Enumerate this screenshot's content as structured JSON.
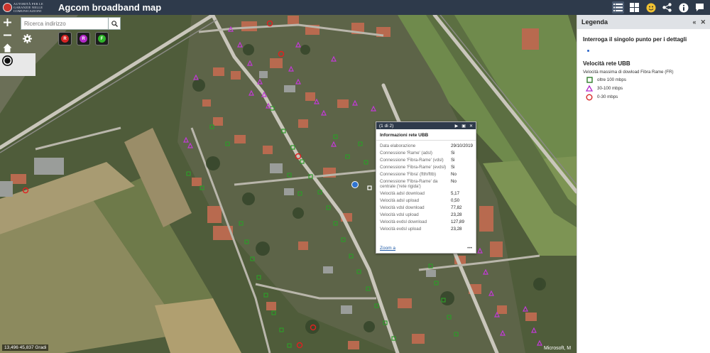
{
  "header": {
    "logo_text_line1": "AUTORITÀ PER LE",
    "logo_text_line2": "GARANZIE NELLE",
    "logo_text_line3": "COMUNICAZIONI",
    "title": "Agcom broadband map",
    "icons": [
      "list-icon",
      "grid-icon",
      "smiley-icon",
      "share-icon",
      "info-icon",
      "chat-icon"
    ]
  },
  "map": {
    "search_placeholder": "Ricerca indirizzo",
    "layer_buttons": [
      {
        "letter": "R",
        "color": "#d62424"
      },
      {
        "letter": "R",
        "color": "#b328c9"
      },
      {
        "letter": "F",
        "color": "#2fb52a"
      }
    ],
    "scale_text": "13,496 45,837 Gradi",
    "attribution": "Microsoft, M"
  },
  "popup": {
    "counter": "(1 di 2)",
    "title": "Informazioni rete UBB",
    "rows": [
      {
        "label": "Data elaborazione",
        "value": "29/10/2019"
      },
      {
        "label": "Connessione 'Rame' (adsl)",
        "value": "Si"
      },
      {
        "label": "Connessione 'Fibra-Rame' (vdsl)",
        "value": "Si"
      },
      {
        "label": "Connessione 'Fibra-Rame' (evdsl)",
        "value": "Si"
      },
      {
        "label": "Connessione 'Fibra' (ftth/fttb)",
        "value": "No"
      },
      {
        "label": "Connessione 'Fibra-Rame' da centrale ('rete rigida')",
        "value": "No"
      },
      {
        "label": "Velocità adsl download",
        "value": "5,17"
      },
      {
        "label": "Velocità adsl upload",
        "value": "0,50"
      },
      {
        "label": "Velocità vdsl download",
        "value": "77,82"
      },
      {
        "label": "Velocità vdsl upload",
        "value": "23,28"
      },
      {
        "label": "Velocità evdsl download",
        "value": "127,89"
      },
      {
        "label": "Velocità evdsl upload",
        "value": "23,28"
      }
    ],
    "zoom_label": "Zoom a",
    "more_label": "•••"
  },
  "legend": {
    "title": "Legenda",
    "intro": "Interroga il singolo punto per i dettagli",
    "section_title": "Velocità rete UBB",
    "subtitle": "Velocità massima di dowload Fibra Rame (FR)",
    "items": [
      {
        "label": "oltre 100 mbps",
        "shape": "square",
        "color": "#2f7d2a"
      },
      {
        "label": "30-100 mbps",
        "shape": "triangle",
        "color": "#b328c9"
      },
      {
        "label": "0-30 mbps",
        "shape": "circle",
        "color": "#d62424"
      }
    ]
  }
}
